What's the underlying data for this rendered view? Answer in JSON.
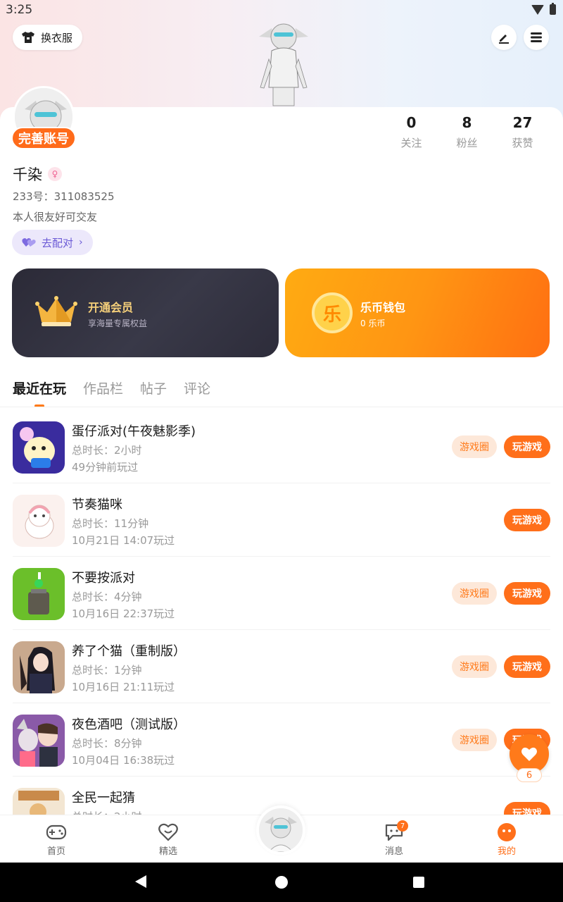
{
  "status": {
    "time": "3:25"
  },
  "header": {
    "outfit_label": "换衣服"
  },
  "profile": {
    "perfect_label": "完善账号",
    "name": "千染",
    "uid": "233号：311083525",
    "bio": "本人很友好可交友",
    "match_label": "去配对"
  },
  "stats": [
    {
      "value": "0",
      "label": "关注"
    },
    {
      "value": "8",
      "label": "粉丝"
    },
    {
      "value": "27",
      "label": "获赞"
    }
  ],
  "vip": {
    "title": "开通会员",
    "subtitle": "享海量专属权益"
  },
  "wallet": {
    "title": "乐币钱包",
    "subtitle": "0 乐币",
    "coin_glyph": "乐"
  },
  "tabs": [
    {
      "label": "最近在玩"
    },
    {
      "label": "作品栏"
    },
    {
      "label": "帖子"
    },
    {
      "label": "评论"
    }
  ],
  "games": [
    {
      "name": "蛋仔派对(午夜魅影季)",
      "duration": "总时长：2小时",
      "last": "49分钟前玩过",
      "has_circle": true
    },
    {
      "name": "节奏猫咪",
      "duration": "总时长：11分钟",
      "last": "10月21日 14:07玩过",
      "has_circle": false
    },
    {
      "name": "不要按派对",
      "duration": "总时长：4分钟",
      "last": "10月16日 22:37玩过",
      "has_circle": true
    },
    {
      "name": "养了个猫（重制版）",
      "duration": "总时长：1分钟",
      "last": "10月16日 21:11玩过",
      "has_circle": true
    },
    {
      "name": "夜色酒吧（测试版）",
      "duration": "总时长：8分钟",
      "last": "10月04日 16:38玩过",
      "has_circle": true
    },
    {
      "name": "全民一起猜",
      "duration": "总时长：2小时",
      "last": "",
      "has_circle": false
    }
  ],
  "game_buttons": {
    "circle": "游戏圈",
    "play": "玩游戏"
  },
  "float_like": {
    "count": "6"
  },
  "nav": {
    "items": [
      {
        "label": "首页"
      },
      {
        "label": "精选"
      },
      {
        "label": "消息"
      },
      {
        "label": "我的"
      }
    ],
    "message_badge": "7"
  },
  "colors": {
    "accent": "#ff6f1a",
    "vip_gold": "#f6d07a",
    "match_purple": "#6b5ad6"
  }
}
